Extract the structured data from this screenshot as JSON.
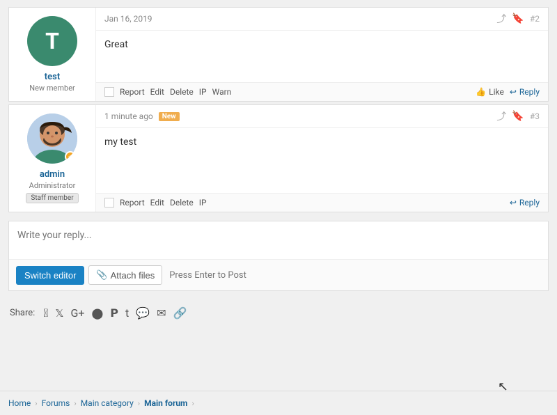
{
  "post1": {
    "date": "Jan 16, 2019",
    "post_num": "#2",
    "content": "Great",
    "user": {
      "initial": "T",
      "name": "test",
      "role": "New member"
    },
    "actions": [
      "Report",
      "Edit",
      "Delete",
      "IP",
      "Warn"
    ],
    "like_label": "Like",
    "reply_label": "Reply"
  },
  "post2": {
    "date": "1 minute ago",
    "post_num": "#3",
    "is_new": true,
    "new_label": "New",
    "content": "my test",
    "user": {
      "name": "admin",
      "role": "Administrator",
      "staff_label": "Staff member"
    },
    "actions": [
      "Report",
      "Edit",
      "Delete",
      "IP"
    ],
    "reply_label": "Reply"
  },
  "reply_editor": {
    "placeholder": "Write your reply...",
    "switch_editor_label": "Switch editor",
    "attach_files_label": "Attach files",
    "press_enter_hint": "Press Enter to Post"
  },
  "share": {
    "label": "Share:",
    "icons": [
      "facebook",
      "twitter",
      "google-plus",
      "reddit",
      "pinterest",
      "tumblr",
      "whatsapp",
      "email",
      "link"
    ]
  },
  "breadcrumb": {
    "items": [
      "Home",
      "Forums",
      "Main category",
      "Main forum"
    ],
    "active": "Main forum"
  }
}
